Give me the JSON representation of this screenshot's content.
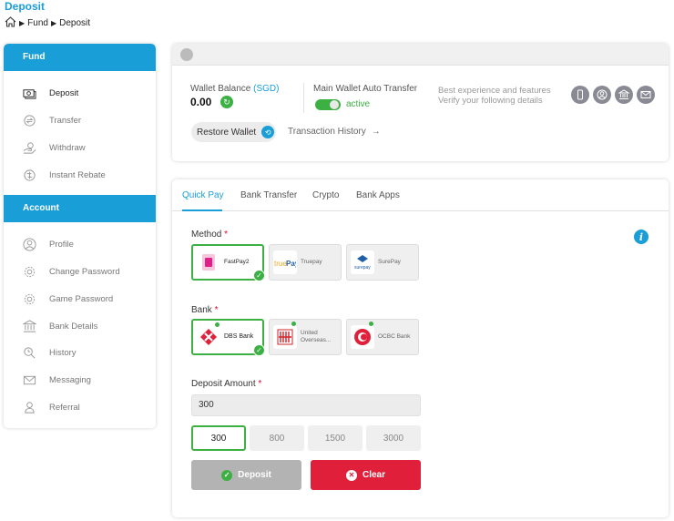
{
  "page": {
    "title": "Deposit",
    "breadcrumb": [
      "Fund",
      "Deposit"
    ]
  },
  "sidebar": {
    "sections": [
      {
        "header": "Fund",
        "items": [
          {
            "label": "Deposit",
            "icon": "deposit-icon",
            "active": true
          },
          {
            "label": "Transfer",
            "icon": "transfer-icon"
          },
          {
            "label": "Withdraw",
            "icon": "withdraw-icon"
          },
          {
            "label": "Instant Rebate",
            "icon": "rebate-icon"
          }
        ]
      },
      {
        "header": "Account",
        "items": [
          {
            "label": "Profile",
            "icon": "user-icon"
          },
          {
            "label": "Change Password",
            "icon": "gear-icon"
          },
          {
            "label": "Game Password",
            "icon": "gear-icon"
          },
          {
            "label": "Bank Details",
            "icon": "bank-icon"
          },
          {
            "label": "History",
            "icon": "history-icon"
          },
          {
            "label": "Messaging",
            "icon": "envelope-icon"
          },
          {
            "label": "Referral",
            "icon": "referral-icon"
          }
        ]
      }
    ]
  },
  "wallet": {
    "balance_label": "Wallet Balance",
    "currency": "(SGD)",
    "balance": "0.00",
    "auto_transfer_label": "Main Wallet Auto Transfer",
    "auto_transfer_status": "active",
    "verify_line1": "Best experience and features",
    "verify_line2": "Verify your following details",
    "verify_icons": [
      "phone-icon",
      "user-icon",
      "bank-icon",
      "envelope-icon"
    ],
    "restore_label": "Restore Wallet",
    "history_label": "Transaction History"
  },
  "deposit": {
    "tabs": [
      "Quick Pay",
      "Bank Transfer",
      "Crypto",
      "Bank Apps"
    ],
    "active_tab": "Quick Pay",
    "method_label": "Method",
    "methods": [
      {
        "name": "FastPay2",
        "selected": true
      },
      {
        "name": "Truepay",
        "selected": false
      },
      {
        "name": "SurePay",
        "selected": false
      }
    ],
    "bank_label": "Bank",
    "banks": [
      {
        "name": "DBS Bank",
        "selected": true
      },
      {
        "name": "United Overseas...",
        "selected": false
      },
      {
        "name": "OCBC Bank",
        "selected": false
      }
    ],
    "amount_label": "Deposit Amount",
    "amount_value": "300",
    "quick_amounts": [
      "300",
      "800",
      "1500",
      "3000"
    ],
    "deposit_button": "Deposit",
    "clear_button": "Clear"
  },
  "colors": {
    "accent": "#1a9ed8",
    "success": "#3cb043",
    "danger": "#e0203a",
    "disabled": "#b3b3b3"
  }
}
